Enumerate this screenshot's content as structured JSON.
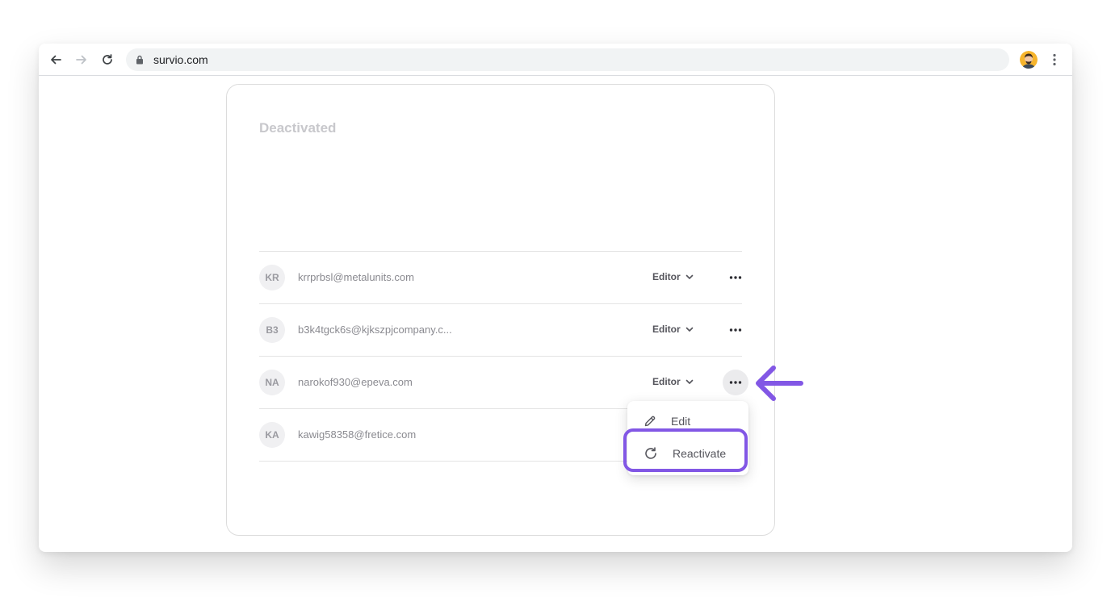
{
  "browser": {
    "url": "survio.com",
    "icons": [
      "back-icon",
      "forward-icon",
      "reload-icon",
      "lock-icon",
      "profile-avatar",
      "more-vert-icon"
    ]
  },
  "section": {
    "title": "Deactivated"
  },
  "members": [
    {
      "initials": "KR",
      "email": "krrprbsl@metalunits.com",
      "role": "Editor"
    },
    {
      "initials": "B3",
      "email": "b3k4tgck6s@kjkszpjcompany.c...",
      "role": "Editor"
    },
    {
      "initials": "NA",
      "email": "narokof930@epeva.com",
      "role": "Editor"
    },
    {
      "initials": "KA",
      "email": "kawig58358@fretice.com",
      "role": ""
    }
  ],
  "menu": {
    "edit_label": "Edit",
    "reactivate_label": "Reactivate"
  },
  "colors": {
    "accent": "#8257e5"
  }
}
